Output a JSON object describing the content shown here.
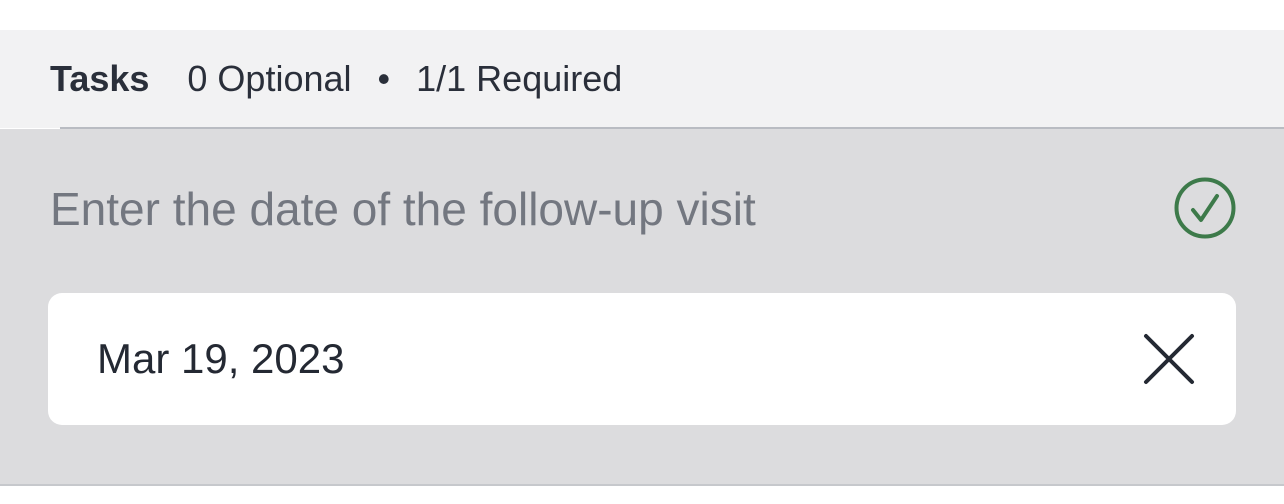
{
  "tasks_header": {
    "title": "Tasks",
    "optional": "0 Optional",
    "separator": "•",
    "required": "1/1 Required"
  },
  "task": {
    "question": "Enter the date of the follow-up visit",
    "status_icon": "check-circle-icon",
    "completed": true,
    "date_value": "Mar 19, 2023",
    "clear_icon": "close-icon"
  },
  "colors": {
    "header_bg": "#f2f2f3",
    "panel_bg": "#dcdcde",
    "success": "#3d7a4a",
    "text_primary": "#242933",
    "text_muted": "#737780"
  }
}
